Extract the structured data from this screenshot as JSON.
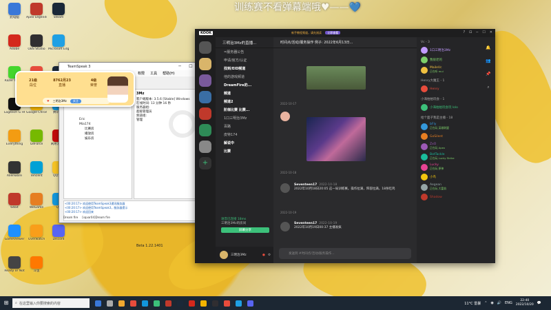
{
  "banner": "训练赛不看弹幕端哦♥——💙",
  "desktop_icons": [
    {
      "label": "此电脑",
      "color": "#3a78d8"
    },
    {
      "label": "Apex Legends",
      "color": "#c0392b"
    },
    {
      "label": "Steam",
      "color": "#1b2838"
    },
    {
      "label": "Adobe",
      "color": "#d4281c"
    },
    {
      "label": "OBS Studio",
      "color": "#302e31"
    },
    {
      "label": "Microsoft Edge",
      "color": "#1fa0e4"
    },
    {
      "label": "Razer Cortex",
      "color": "#44d62c"
    },
    {
      "label": "网易UU",
      "color": "#e74c3c"
    },
    {
      "label": "Steam",
      "color": "#1b2838"
    },
    {
      "label": "Logitech G HUB",
      "color": "#111"
    },
    {
      "label": "Google Chrome",
      "color": "#f4b400"
    },
    {
      "label": "腾讯QQ",
      "color": "#1296db"
    },
    {
      "label": "Everything",
      "color": "#f39c12"
    },
    {
      "label": "GeForce",
      "color": "#76b900"
    },
    {
      "label": "网易云音乐",
      "color": "#c20c0c"
    },
    {
      "label": "Alienware",
      "color": "#333"
    },
    {
      "label": "Tencent",
      "color": "#00a1d6"
    },
    {
      "label": "QQ音乐",
      "color": "#f6c324"
    },
    {
      "label": "64bit",
      "color": "#c0392b"
    },
    {
      "label": "WeGame",
      "color": "#e67e22"
    },
    {
      "label": "QQ",
      "color": "#1296db"
    },
    {
      "label": "GameViewer",
      "color": "#1e90ff"
    },
    {
      "label": "Overwatch",
      "color": "#f99e1a"
    },
    {
      "label": "Discord",
      "color": "#5865f2"
    },
    {
      "label": "Ready or Not",
      "color": "#444"
    },
    {
      "label": "斗鱼",
      "color": "#ff7800"
    }
  ],
  "teamspeak": {
    "title": "TeamSpeak 3",
    "menu": [
      "连接",
      "书签",
      "自身",
      "权限",
      "工具",
      "帮助(H)"
    ],
    "tree": [
      "Eric",
      "Mia174",
      "比赛房",
      "播放房",
      "娱乐房"
    ],
    "info_title": "3Mz",
    "info": [
      "客户端版本: 3.5.6 [Stable] Windows",
      "在线时间: 13 分钟 16 秒",
      "服务器组:",
      "超级管理员",
      "频道组:",
      "管理"
    ],
    "log": [
      "<00:20:17> 欢迎使用TeamSpeak3通讯服务器",
      "<00:20:17> 欢迎使用TeamSpeak3，服务器提示",
      "<00:20:17> 欢迎回来"
    ],
    "tabs": [
      "Dream fire",
      "[sqvar04]Dream fire"
    ],
    "status": "Beta 1.22.1401"
  },
  "overlay": {
    "stats": [
      {
        "value": "21级",
        "label": "段位"
      },
      {
        "value": "8762月23",
        "label": "直播"
      },
      {
        "value": "4级",
        "label": "荣誉"
      }
    ],
    "pill_name": "三明治3Mz",
    "pill_button": "关注"
  },
  "kook": {
    "logo": "KOOK",
    "notice": "新手教程频道，请先阅读",
    "notice_button": "立即查看",
    "server_name": "三明治3Mz的直播...",
    "channels": [
      {
        "label": "=服务器公告",
        "bold": false
      },
      {
        "label": "申请/官方/认证",
        "bold": false
      },
      {
        "label": "找到/EID频道",
        "bold": true
      },
      {
        "label": "他的游戏频道",
        "bold": false
      },
      {
        "label": "DreamFire的...",
        "bold": true
      },
      {
        "label": "频道",
        "bold": true
      },
      {
        "label": "频道2",
        "bold": true
      },
      {
        "label": "阶梯比赛 比赛...",
        "bold": true
      },
      {
        "label": "1口三明治3Mz",
        "bold": false
      },
      {
        "label": "百路",
        "bold": false
      },
      {
        "label": "皮特174",
        "bold": false
      },
      {
        "label": "解说中",
        "bold": true
      },
      {
        "label": "比赛",
        "bold": true
      }
    ],
    "voice_status": "语音已连接 18ms",
    "voice_channel": "三明治3Mz的房间",
    "voice_button": "屏幕分享",
    "username": "三明治3Mz",
    "channel_title": "时间点/活动/服务操作  例子: 2022年6月13日...",
    "dates": [
      "2022-10-17",
      "2022-10-18",
      "2022-10-19"
    ],
    "messages": [
      {
        "name": "Seventeen17",
        "time": "2022-10-18",
        "text": "2022年10月18日20:05 这一局训练赛。操作拉满，阵容拉满，18杀吃鸡"
      },
      {
        "name": "Seventeen17",
        "time": "2022-10-19",
        "text": "2022年10月19日00:37 主播发疯"
      }
    ],
    "input_placeholder": "发送到 #时间点/活动/服务操作...",
    "member_groups": [
      {
        "title": "Vc - 3",
        "members": [
          {
            "name": "1口三明治3Mz",
            "sub": "",
            "color": "#c29bff"
          },
          {
            "name": "我很老的",
            "sub": "",
            "color": "#7ecf6a"
          },
          {
            "name": "MaileVc",
            "sub": "正在听 mui",
            "color": "#f0c040"
          }
        ]
      },
      {
        "title": "Henry大魔王 - 1",
        "members": [
          {
            "name": "Henry",
            "sub": "",
            "color": "#e74c3c"
          }
        ]
      },
      {
        "title": "小海拍拍玩会 - 1",
        "members": [
          {
            "name": "小海拍拍玩会玩 lolo",
            "sub": "",
            "color": "#3cc07a"
          }
        ]
      },
      {
        "title": "给个面子我是主播 - 18",
        "members": [
          {
            "name": "bFly",
            "sub": "正在玩 英雄联盟",
            "color": "#3498db"
          },
          {
            "name": "GoSilent",
            "sub": "",
            "color": "#e67e22"
          },
          {
            "name": "ZxO",
            "sub": "正在玩 Apex",
            "color": "#9b59b6"
          },
          {
            "name": "BotTackle",
            "sub": "正在玩 Lucky Strike",
            "color": "#1abc9c"
          },
          {
            "name": "Lucky",
            "sub": "正在玩 原神",
            "color": "#e84393"
          },
          {
            "name": "小鸟",
            "sub": "",
            "color": "#f1c40f"
          },
          {
            "name": "Aegean",
            "sub": "正在玩 大富翁",
            "color": "#95a5a6"
          },
          {
            "name": "Shadow",
            "sub": "",
            "color": "#c0392b"
          }
        ]
      }
    ]
  },
  "taskbar": {
    "search_placeholder": "在这里输入你要搜索的内容",
    "weather": "11°C 雷暴",
    "lang": "ENG",
    "time": "22:40",
    "date": "2022/10/20",
    "app_colors": [
      "#3a78d8",
      "#aaa",
      "#f0a830",
      "#e74c3c",
      "#1296db",
      "#3cc07a",
      "#c0392b",
      "#1b2838",
      "#d4281c",
      "#f4b400",
      "#302e31",
      "#e74c3c",
      "#1fa0e4",
      "#5865f2"
    ]
  }
}
